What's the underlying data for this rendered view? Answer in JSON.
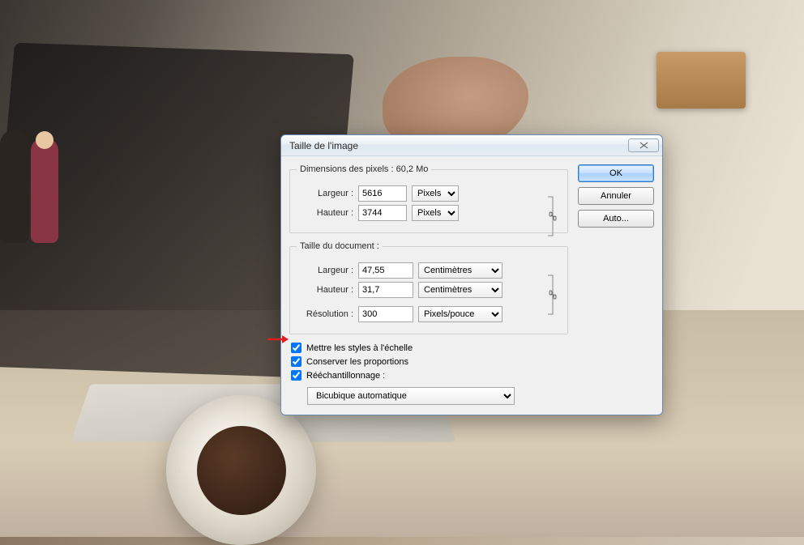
{
  "dialog": {
    "title": "Taille de l'image",
    "buttons": {
      "ok": "OK",
      "cancel": "Annuler",
      "auto": "Auto..."
    }
  },
  "pixel_dims": {
    "legend": "Dimensions des pixels : 60,2 Mo",
    "width_label": "Largeur :",
    "width_value": "5616",
    "width_unit": "Pixels",
    "height_label": "Hauteur :",
    "height_value": "3744",
    "height_unit": "Pixels"
  },
  "doc_size": {
    "legend": "Taille du document :",
    "width_label": "Largeur :",
    "width_value": "47,55",
    "width_unit": "Centimètres",
    "height_label": "Hauteur :",
    "height_value": "31,7",
    "height_unit": "Centimètres",
    "res_label": "Résolution :",
    "res_value": "300",
    "res_unit": "Pixels/pouce"
  },
  "options": {
    "scale_styles": "Mettre les styles à l'échelle",
    "constrain": "Conserver les proportions",
    "resample": "Rééchantillonnage :",
    "resample_method": "Bicubique automatique"
  }
}
